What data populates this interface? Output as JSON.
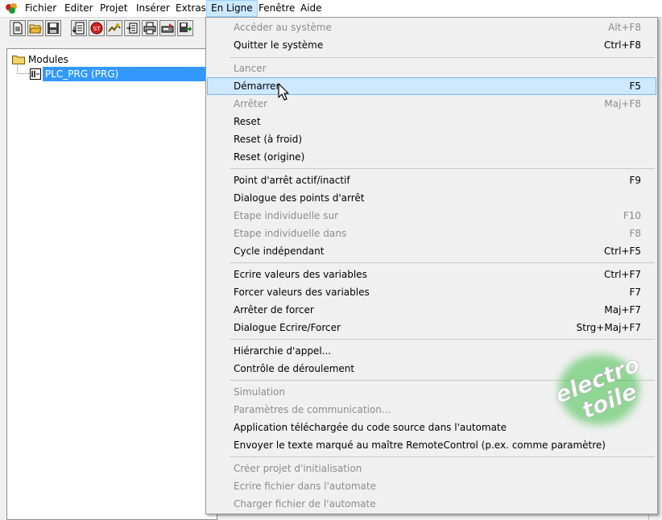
{
  "menubar": {
    "items": [
      "Fichier",
      "Editer",
      "Projet",
      "Insérer",
      "Extras",
      "En Ligne",
      "Fenêtre",
      "Aide"
    ],
    "open_index": 5
  },
  "toolbar": {
    "buttons": [
      "new-icon",
      "open-folder-icon",
      "save-icon",
      "build-icon",
      "stop-icon",
      "login-icon",
      "watch-icon",
      "print-icon",
      "compile-icon",
      "export-icon"
    ]
  },
  "tree": {
    "root": "Modules",
    "item": "PLC_PRG (PRG)"
  },
  "dropdown": {
    "items": [
      {
        "label": "Accéder au système",
        "shortcut": "Alt+F8",
        "disabled": true
      },
      {
        "label": "Quitter le système",
        "shortcut": "Ctrl+F8",
        "disabled": false
      },
      {
        "label": "Lancer",
        "shortcut": "",
        "disabled": true
      },
      {
        "label": "Démarrer",
        "shortcut": "F5",
        "disabled": false,
        "highlighted": true
      },
      {
        "label": "Arrêter",
        "shortcut": "Maj+F8",
        "disabled": true
      },
      {
        "label": "Reset",
        "shortcut": "",
        "disabled": false
      },
      {
        "label": "Reset (à froid)",
        "shortcut": "",
        "disabled": false
      },
      {
        "label": "Reset (origine)",
        "shortcut": "",
        "disabled": false
      },
      {
        "label": "Point d'arrêt actif/inactif",
        "shortcut": "F9",
        "disabled": false
      },
      {
        "label": "Dialogue des points d'arrêt",
        "shortcut": "",
        "disabled": false
      },
      {
        "label": "Etape individuelle sur",
        "shortcut": "F10",
        "disabled": true
      },
      {
        "label": "Etape individuelle dans",
        "shortcut": "F8",
        "disabled": true
      },
      {
        "label": "Cycle indépendant",
        "shortcut": "Ctrl+F5",
        "disabled": false
      },
      {
        "label": "Ecrire valeurs des variables",
        "shortcut": "Ctrl+F7",
        "disabled": false
      },
      {
        "label": "Forcer valeurs des variables",
        "shortcut": "F7",
        "disabled": false
      },
      {
        "label": "Arrêter de forcer",
        "shortcut": "Maj+F7",
        "disabled": false
      },
      {
        "label": "Dialogue Ecrire/Forcer",
        "shortcut": "Strg+Maj+F7",
        "disabled": false
      },
      {
        "label": "Hiérarchie d'appel...",
        "shortcut": "",
        "disabled": false
      },
      {
        "label": "Contrôle de déroulement",
        "shortcut": "",
        "disabled": false
      },
      {
        "label": "Simulation",
        "shortcut": "",
        "disabled": true
      },
      {
        "label": "Paramètres de communication...",
        "shortcut": "",
        "disabled": true
      },
      {
        "label": "Application téléchargée du code source dans l'automate",
        "shortcut": "",
        "disabled": false
      },
      {
        "label": "Envoyer le texte marqué au maître RemoteControl  (p.ex. comme paramètre)",
        "shortcut": "",
        "disabled": false
      },
      {
        "label": "Créer projet d'initialisation",
        "shortcut": "",
        "disabled": true
      },
      {
        "label": "Ecrire fichier dans l'automate",
        "shortcut": "",
        "disabled": true
      },
      {
        "label": "Charger fichier de l'automate",
        "shortcut": "",
        "disabled": true
      }
    ]
  },
  "watermark": {
    "line1": "electro",
    "line2": "toile"
  },
  "colors": {
    "highlight": "#cde8ff",
    "selection": "#3399ff",
    "disabled_text": "#8c8c8c",
    "watermark_glow": "#3fbf4a"
  }
}
